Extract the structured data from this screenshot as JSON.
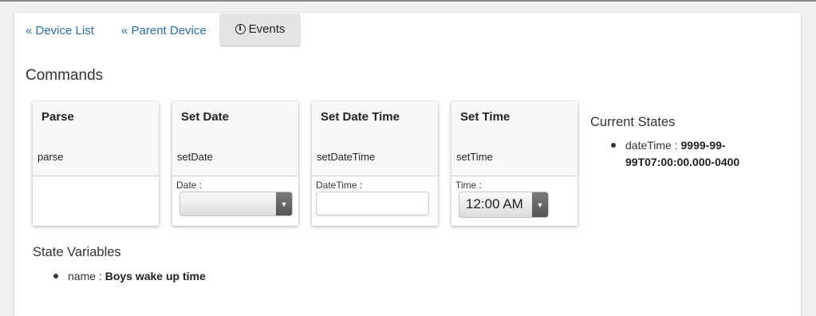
{
  "nav": {
    "device_list": "« Device List",
    "parent_device": "« Parent Device",
    "events": "Events"
  },
  "commands": {
    "title": "Commands",
    "cards": [
      {
        "title": "Parse",
        "command": "parse",
        "field_label": ""
      },
      {
        "title": "Set Date",
        "command": "setDate",
        "field_label": "Date :"
      },
      {
        "title": "Set Date Time",
        "command": "setDateTime",
        "field_label": "DateTime :"
      },
      {
        "title": "Set Time",
        "command": "setTime",
        "field_label": "Time :",
        "value": "12:00 AM"
      }
    ]
  },
  "current_states": {
    "title": "Current States",
    "items": [
      {
        "key": "dateTime :",
        "value_line1": "9999-99-",
        "value_line2": "99T07:00:00.000-0400"
      }
    ]
  },
  "state_variables": {
    "title": "State Variables",
    "items": [
      {
        "key": "name :",
        "value": "Boys wake up time"
      }
    ]
  },
  "colors": {
    "link": "#2a6db0",
    "panel": "#ffffff",
    "background": "#f0f0f0"
  }
}
